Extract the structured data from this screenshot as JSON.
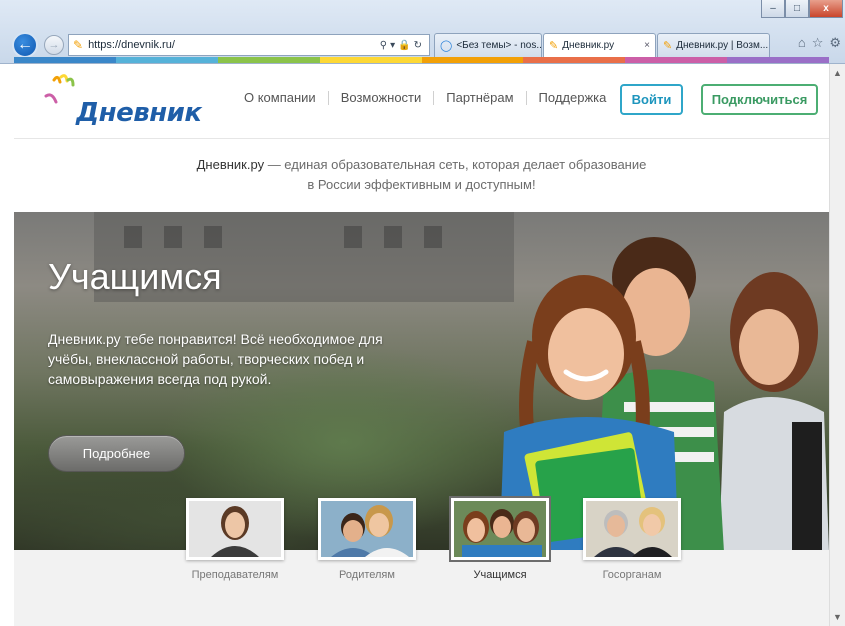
{
  "browser": {
    "url": "https://dnevnik.ru/",
    "window_buttons": [
      "–",
      "□",
      "x"
    ],
    "tabs": [
      {
        "label": "<Без темы> - nos...",
        "icon": "ie-icon",
        "active": false
      },
      {
        "label": "Дневник.ру",
        "icon": "dnevnik-icon",
        "active": true
      },
      {
        "label": "Дневник.ру | Возм...",
        "icon": "dnevnik-icon",
        "active": false
      }
    ],
    "rainbow": [
      "#3a87c9",
      "#55b2d9",
      "#8bc34a",
      "#fdd835",
      "#f2a007",
      "#e96f49",
      "#cc5fa7",
      "#9a6fc7"
    ]
  },
  "header": {
    "logo_text": "Дневник",
    "menu": [
      "О компании",
      "Возможности",
      "Партнёрам",
      "Поддержка"
    ],
    "login_label": "Войти",
    "connect_label": "Подключиться"
  },
  "tagline": {
    "brand": "Дневник.ру",
    "line1_rest": " — единая образовательная сеть, которая делает образование",
    "line2": "в России эффективным и доступным!"
  },
  "hero": {
    "title": "Учащимся",
    "text": "Дневник.ру тебе понравится! Всё необходимое для учёбы, внеклассной работы, творческих побед и самовыражения всегда под рукой.",
    "button_label": "Подробнее"
  },
  "audiences": [
    {
      "label": "Преподавателям",
      "active": false
    },
    {
      "label": "Родителям",
      "active": false
    },
    {
      "label": "Учащимся",
      "active": true
    },
    {
      "label": "Госорганам",
      "active": false
    }
  ],
  "colors": {
    "brand_blue": "#1f5ea8",
    "login_border": "#2fa6c9",
    "connect_border": "#4cae73"
  }
}
